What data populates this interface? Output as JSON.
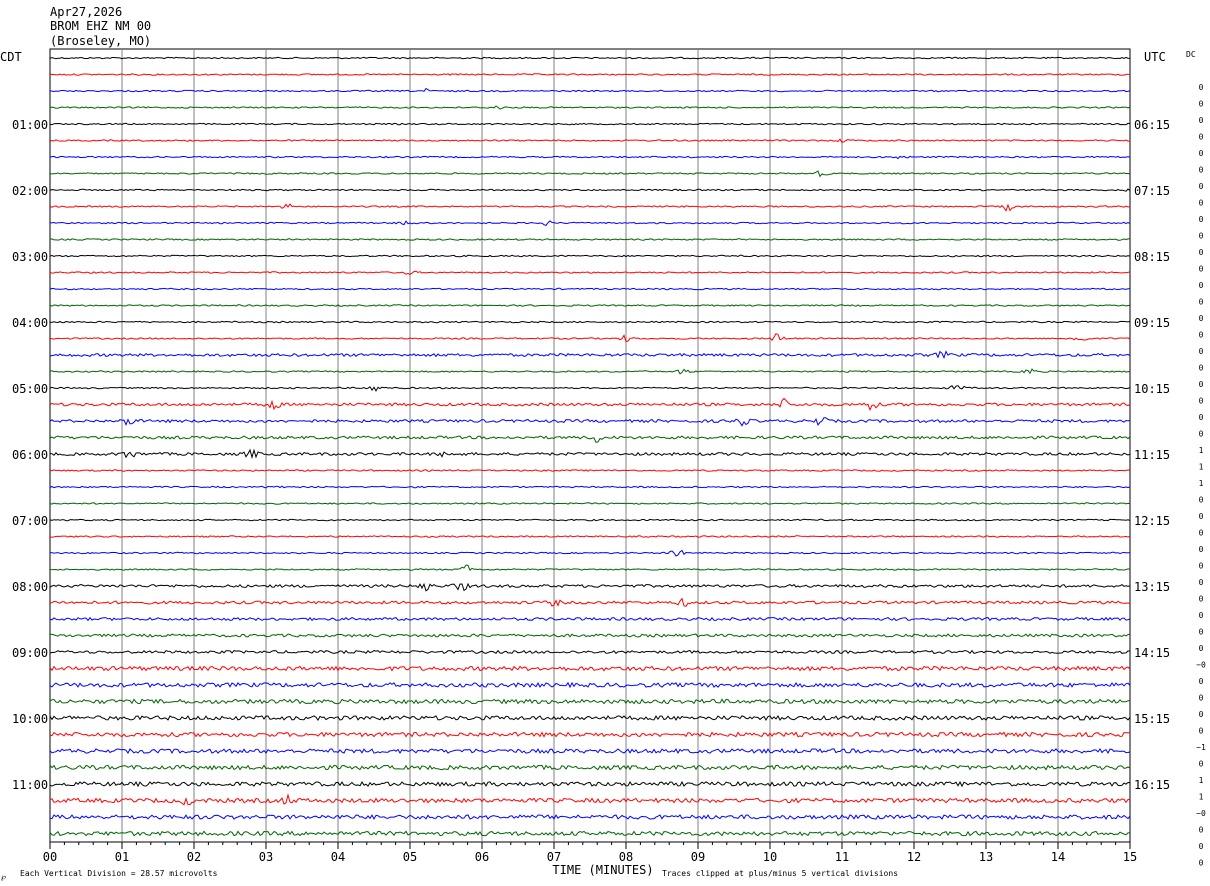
{
  "header": {
    "date": "Apr27,2026",
    "station": "BROM EHZ NM 00",
    "location": "(Broseley, MO)"
  },
  "left_axis_label": "CDT",
  "right_axis_label": "UTC",
  "dc_label": "DC",
  "x_axis_title": "TIME (MINUTES)",
  "footer_left": "Each Vertical Division =   28.57 microvolts",
  "footer_right": "Traces clipped at plus/minus 5 vertical divisions",
  "corner_mark": "℘",
  "chart_data": {
    "type": "line",
    "title": "",
    "xlabel": "TIME (MINUTES)",
    "ylabel": "",
    "xlim": [
      0,
      15
    ],
    "x_ticks": [
      "00",
      "01",
      "02",
      "03",
      "04",
      "05",
      "06",
      "07",
      "08",
      "09",
      "10",
      "11",
      "12",
      "13",
      "14",
      "15"
    ],
    "trace_count": 48,
    "trace_colors": [
      "#000000",
      "#ff0000",
      "#0000ff",
      "#006400"
    ],
    "cdt_hour_labels": [
      "01:00",
      "02:00",
      "03:00",
      "04:00",
      "05:00",
      "06:00",
      "07:00",
      "08:00",
      "09:00",
      "10:00",
      "11:00"
    ],
    "utc_hour_labels": [
      "06:15",
      "07:15",
      "08:15",
      "09:15",
      "10:15",
      "11:15",
      "12:15",
      "13:15",
      "14:15",
      "15:15",
      "16:15"
    ],
    "dc_offsets": [
      "0",
      "0",
      "0",
      "0",
      "0",
      "0",
      "0",
      "0",
      "0",
      "0",
      "0",
      "0",
      "0",
      "0",
      "0",
      "0",
      "0",
      "0",
      "0",
      "0",
      "0",
      "0",
      "1",
      "1",
      "1",
      "0",
      "0",
      "0",
      "0",
      "0",
      "0",
      "0",
      "0",
      "0",
      "0",
      "−0",
      "0",
      "0",
      "0",
      "0",
      "−1",
      "0",
      "1",
      "1",
      "−0",
      "0",
      "0",
      "0"
    ],
    "trace_noise_level": [
      1,
      1,
      1,
      1,
      1,
      1,
      1,
      1,
      1,
      1,
      1,
      1,
      1,
      1,
      1,
      1,
      1,
      1,
      2,
      1,
      1,
      2,
      2,
      2,
      2,
      1,
      1,
      1,
      1,
      1,
      1,
      1,
      2,
      2,
      2,
      2,
      2,
      3,
      3,
      3,
      3,
      3,
      3,
      3,
      3,
      3,
      3,
      3
    ],
    "events": [
      {
        "trace": 2,
        "minute": 5.2,
        "amplitude": 2
      },
      {
        "trace": 3,
        "minute": 6.2,
        "amplitude": 2
      },
      {
        "trace": 5,
        "minute": 11.0,
        "amplitude": 1.5
      },
      {
        "trace": 6,
        "minute": 11.8,
        "amplitude": 2
      },
      {
        "trace": 7,
        "minute": 10.7,
        "amplitude": 3
      },
      {
        "trace": 8,
        "minute": 15.0,
        "amplitude": 2
      },
      {
        "trace": 9,
        "minute": 3.3,
        "amplitude": 3
      },
      {
        "trace": 9,
        "minute": 13.3,
        "amplitude": 4
      },
      {
        "trace": 10,
        "minute": 4.9,
        "amplitude": 3
      },
      {
        "trace": 10,
        "minute": 6.9,
        "amplitude": 2
      },
      {
        "trace": 13,
        "minute": 5.0,
        "amplitude": 2
      },
      {
        "trace": 17,
        "minute": 8.0,
        "amplitude": 3
      },
      {
        "trace": 17,
        "minute": 10.1,
        "amplitude": 5
      },
      {
        "trace": 17,
        "minute": 14.3,
        "amplitude": 5
      },
      {
        "trace": 18,
        "minute": 12.4,
        "amplitude": 3
      },
      {
        "trace": 19,
        "minute": 8.8,
        "amplitude": 3
      },
      {
        "trace": 19,
        "minute": 13.6,
        "amplitude": 3
      },
      {
        "trace": 20,
        "minute": 4.5,
        "amplitude": 4
      },
      {
        "trace": 20,
        "minute": 12.6,
        "amplitude": 4
      },
      {
        "trace": 21,
        "minute": 3.1,
        "amplitude": 5
      },
      {
        "trace": 21,
        "minute": 10.2,
        "amplitude": 5
      },
      {
        "trace": 21,
        "minute": 11.4,
        "amplitude": 5
      },
      {
        "trace": 22,
        "minute": 1.1,
        "amplitude": 5
      },
      {
        "trace": 22,
        "minute": 9.6,
        "amplitude": 5
      },
      {
        "trace": 22,
        "minute": 10.7,
        "amplitude": 5
      },
      {
        "trace": 23,
        "minute": 7.6,
        "amplitude": 4
      },
      {
        "trace": 24,
        "minute": 1.1,
        "amplitude": 4
      },
      {
        "trace": 24,
        "minute": 2.8,
        "amplitude": 4
      },
      {
        "trace": 24,
        "minute": 5.5,
        "amplitude": 3
      },
      {
        "trace": 26,
        "minute": 3.1,
        "amplitude": 3
      },
      {
        "trace": 30,
        "minute": 8.7,
        "amplitude": 5
      },
      {
        "trace": 31,
        "minute": 5.8,
        "amplitude": 5
      },
      {
        "trace": 32,
        "minute": 5.2,
        "amplitude": 5
      },
      {
        "trace": 32,
        "minute": 5.7,
        "amplitude": 5
      },
      {
        "trace": 33,
        "minute": 7.0,
        "amplitude": 3
      },
      {
        "trace": 33,
        "minute": 8.8,
        "amplitude": 3
      },
      {
        "trace": 45,
        "minute": 3.3,
        "amplitude": 4
      },
      {
        "trace": 45,
        "minute": 1.9,
        "amplitude": 3
      }
    ]
  }
}
